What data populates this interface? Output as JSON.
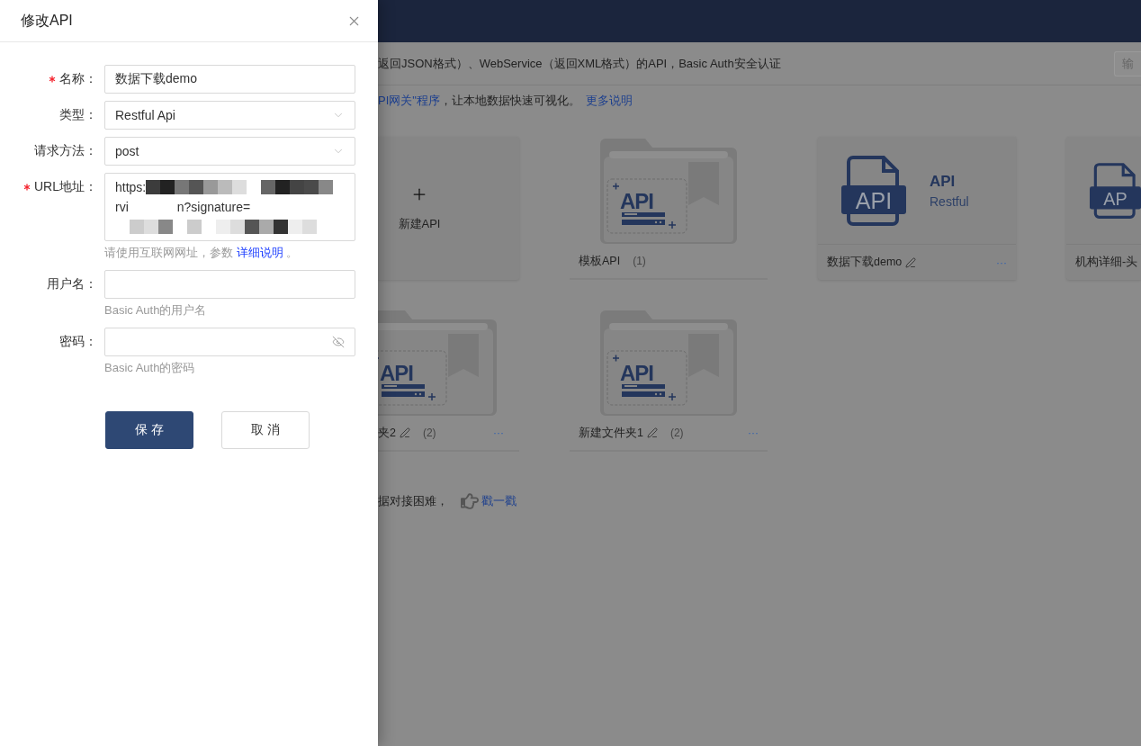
{
  "drawer": {
    "title": "修改API",
    "fields": [
      {
        "kind": "text",
        "label": "名称：",
        "required": true,
        "value": "数据下载demo"
      },
      {
        "kind": "select",
        "label": "类型：",
        "required": false,
        "value": "Restful Api"
      },
      {
        "kind": "select",
        "label": "请求方法：",
        "required": false,
        "value": "post"
      },
      {
        "kind": "url",
        "label": "URL地址：",
        "required": true,
        "value_fragments": [
          "https:",
          "rvi",
          "n?signature="
        ],
        "help": "请使用互联网网址，参数 ",
        "help_link": "详细说明",
        "help_tail": " 。"
      },
      {
        "kind": "text",
        "label": "用户名：",
        "required": false,
        "help": "Basic Auth的用户名"
      },
      {
        "kind": "password",
        "label": "密码：",
        "required": false,
        "help": "Basic Auth的密码"
      }
    ],
    "buttons": [
      {
        "kind": "primary",
        "label": "保 存"
      },
      {
        "kind": "default",
        "label": "取 消"
      }
    ]
  },
  "page": {
    "intro_line_1": "返回JSON格式）、WebService（返回XML格式）的API，Basic Auth安全认证",
    "top_right_button": "输",
    "intro_line_2": {
      "link": "PI网关\"程序",
      "text": "，让本地数据快速可视化。",
      "more_link": "更多说明"
    },
    "card_rows": [
      [
        {
          "kind": "new",
          "label": "新建API"
        },
        {
          "kind": "folder",
          "badge": "API",
          "name": "模板API",
          "editable": false,
          "count": "(1)"
        },
        {
          "kind": "api",
          "badge": "API",
          "title": "API",
          "subtitle": "Restful",
          "name": "数据下载demo",
          "editable": true,
          "menu": "···"
        },
        {
          "kind": "api",
          "badge": "AP",
          "name": "机构详细-头",
          "editable": false
        }
      ],
      [
        {
          "kind": "folder",
          "badge": "API",
          "name": "夹2",
          "editable": true,
          "count": "(2)",
          "menu": "···"
        },
        {
          "kind": "folder",
          "badge": "API",
          "name": "新建文件夹1",
          "editable": true,
          "count": "(2)",
          "menu": "···"
        }
      ]
    ],
    "footer": {
      "text": "据对接困难，",
      "link": "戳一戳"
    }
  }
}
